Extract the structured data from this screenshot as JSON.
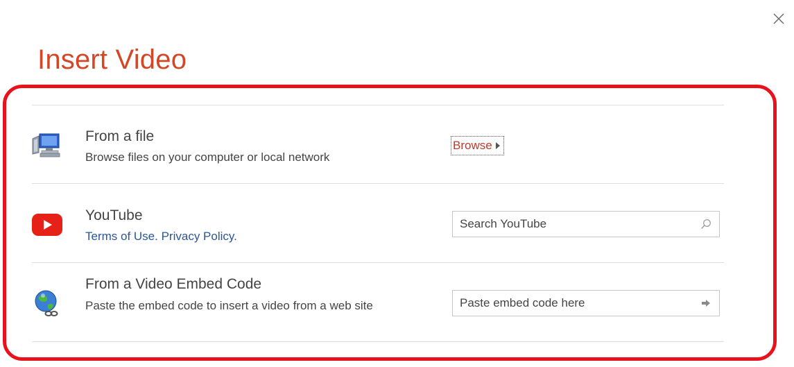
{
  "dialog": {
    "title": "Insert Video",
    "close_icon": "close-icon"
  },
  "colors": {
    "title": "#d24726",
    "highlight_frame": "#e8121c",
    "link": "#2b5797",
    "browse": "#c0392b",
    "divider": "#dedede"
  },
  "options": {
    "file": {
      "title": "From a file",
      "description": "Browse files on your computer or local network",
      "icon": "computer-network-icon",
      "browse_label": "Browse"
    },
    "youtube": {
      "title": "YouTube",
      "terms_link": "Terms of Use.",
      "privacy_link": "Privacy Policy.",
      "icon": "youtube-icon",
      "search_placeholder": "Search YouTube",
      "search_icon": "search-icon"
    },
    "embed": {
      "title": "From a Video Embed Code",
      "description": "Paste the embed code to insert a video from a web site",
      "icon": "globe-link-icon",
      "embed_placeholder": "Paste embed code here",
      "submit_icon": "arrow-right-icon"
    }
  }
}
